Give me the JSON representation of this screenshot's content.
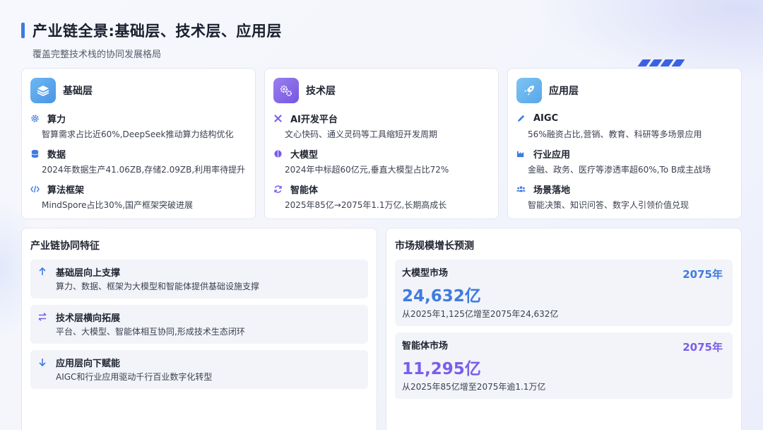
{
  "header": {
    "title": "产业链全景:基础层、技术层、应用层",
    "subtitle": "覆盖完整技术栈的协同发展格局"
  },
  "colors": {
    "accent_blue": "#3f7be0",
    "purple": "#7b5ee8",
    "infra_icon_bg": "#5aa8ef",
    "app_icon_bg": "#69b6f0"
  },
  "layers": [
    {
      "title": "基础层",
      "icon": "layers-icon",
      "items": [
        {
          "title": "算力",
          "icon": "gear-icon",
          "desc": "智算需求占比近60%,DeepSeek推动算力结构优化"
        },
        {
          "title": "数据",
          "icon": "database-icon",
          "desc": "2024年数据生产41.06ZB,存储2.09ZB,利用率待提升"
        },
        {
          "title": "算法框架",
          "icon": "code-icon",
          "desc": "MindSpore占比30%,国产框架突破进展"
        }
      ]
    },
    {
      "title": "技术层",
      "icon": "cogs-icon",
      "items": [
        {
          "title": "AI开发平台",
          "icon": "tools-icon",
          "desc": "文心快码、通义灵码等工具缩短开发周期"
        },
        {
          "title": "大模型",
          "icon": "brain-icon",
          "desc": "2024年中标超60亿元,垂直大模型占比72%"
        },
        {
          "title": "智能体",
          "icon": "refresh-icon",
          "desc": "2025年85亿→2075年1.1万亿,长期高成长"
        }
      ]
    },
    {
      "title": "应用层",
      "icon": "rocket-icon",
      "items": [
        {
          "title": "AIGC",
          "icon": "pen-icon",
          "desc": "56%融资占比,营销、教育、科研等多场景应用"
        },
        {
          "title": "行业应用",
          "icon": "industry-icon",
          "desc": "金融、政务、医疗等渗透率超60%,To B成主战场"
        },
        {
          "title": "场景落地",
          "icon": "users-icon",
          "desc": "智能决策、知识问答、数字人引领价值兑现"
        }
      ]
    }
  ],
  "synergy": {
    "title": "产业链协同特征",
    "rows": [
      {
        "title": "基础层向上支撑",
        "icon": "arrow-up-icon",
        "desc": "算力、数据、框架为大模型和智能体提供基础设施支撑"
      },
      {
        "title": "技术层横向拓展",
        "icon": "arrows-horizontal-icon",
        "desc": "平台、大模型、智能体相互协同,形成技术生态闭环"
      },
      {
        "title": "应用层向下赋能",
        "icon": "arrow-down-icon",
        "desc": "AIGC和行业应用驱动千行百业数字化转型"
      }
    ]
  },
  "market": {
    "title": "市场规模增长预测",
    "rows": [
      {
        "label": "大模型市场",
        "year": "2075年",
        "value": "24,632亿",
        "desc": "从2025年1,125亿增至2075年24,632亿",
        "color": "#3f7be0"
      },
      {
        "label": "智能体市场",
        "year": "2075年",
        "value": "11,295亿",
        "desc": "从2025年85亿增至2075年逾1.1万亿",
        "color": "#7b5ee8"
      }
    ]
  }
}
